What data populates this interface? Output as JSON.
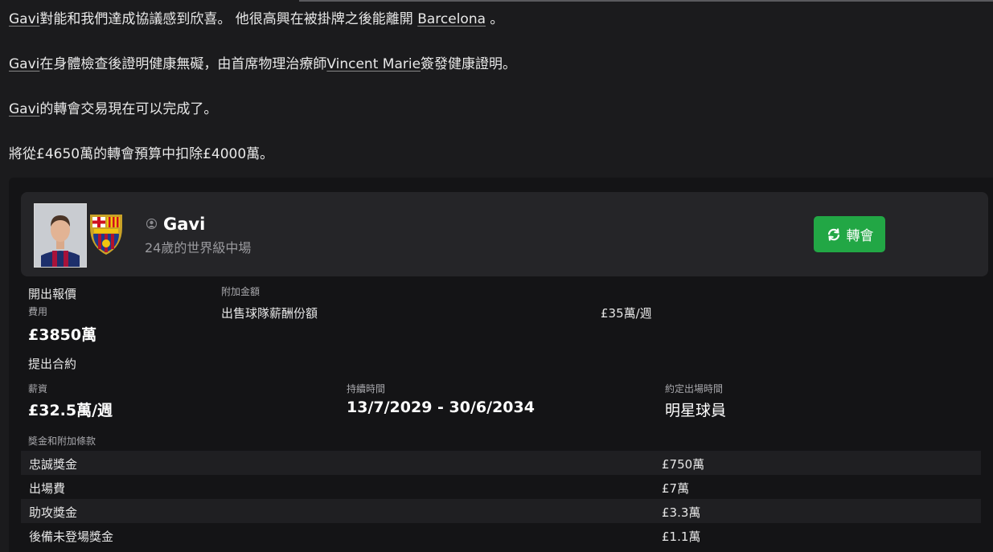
{
  "messages": {
    "line1_player": "Gavi",
    "line1_text": "對能和我們達成協議感到欣喜。 他很高興在被掛牌之後能離開 ",
    "line1_club": "Barcelona",
    "line1_end": " 。",
    "line2_player": "Gavi",
    "line2_text": "在身體檢查後證明健康無礙，由首席物理治療師",
    "line2_physio": "Vincent Marie",
    "line2_end": "簽發健康證明。",
    "line3_player": "Gavi",
    "line3_text": "的轉會交易現在可以完成了。",
    "line4_text": "將從£4650萬的轉會預算中扣除£4000萬。"
  },
  "player": {
    "name": "Gavi",
    "subtitle": "24歲的世界級中場",
    "status_icon": "person-icon",
    "club_crest": "fcb-crest",
    "photo": "player-photo"
  },
  "transfer_button": {
    "label": "轉會",
    "icon": "refresh-icon",
    "color": "#22a745"
  },
  "offer": {
    "heading": "開出報價",
    "fee_label": "費用",
    "fee_value": "£3850萬",
    "addon_label": "附加金額",
    "addon_item": "出售球隊薪酬份額",
    "addon_value": "£35萬/週"
  },
  "contract": {
    "heading": "提出合約",
    "wage_label": "薪資",
    "wage_value": "£32.5萬/週",
    "duration_label": "持續時間",
    "duration_value": "13/7/2029 - 30/6/2034",
    "playing_time_label": "約定出場時間",
    "playing_time_value": "明星球員"
  },
  "bonuses": {
    "heading": "獎金和附加條款",
    "rows": [
      {
        "name": "忠誠獎金",
        "value": "£750萬"
      },
      {
        "name": "出場費",
        "value": "£7萬"
      },
      {
        "name": "助攻獎金",
        "value": "£3.3萬"
      },
      {
        "name": "後備未登場獎金",
        "value": "£1.1萬"
      }
    ]
  }
}
